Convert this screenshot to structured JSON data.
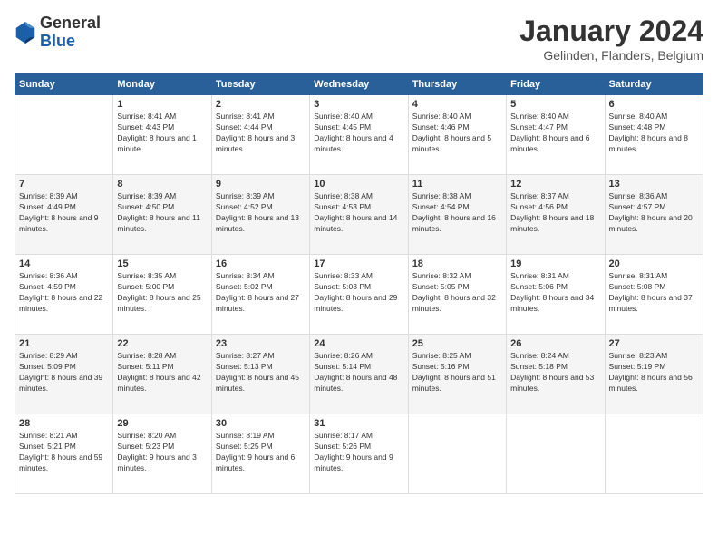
{
  "header": {
    "logo_general": "General",
    "logo_blue": "Blue",
    "month_title": "January 2024",
    "subtitle": "Gelinden, Flanders, Belgium"
  },
  "columns": [
    "Sunday",
    "Monday",
    "Tuesday",
    "Wednesday",
    "Thursday",
    "Friday",
    "Saturday"
  ],
  "weeks": [
    [
      {
        "day": "",
        "sunrise": "",
        "sunset": "",
        "daylight": ""
      },
      {
        "day": "1",
        "sunrise": "Sunrise: 8:41 AM",
        "sunset": "Sunset: 4:43 PM",
        "daylight": "Daylight: 8 hours and 1 minute."
      },
      {
        "day": "2",
        "sunrise": "Sunrise: 8:41 AM",
        "sunset": "Sunset: 4:44 PM",
        "daylight": "Daylight: 8 hours and 3 minutes."
      },
      {
        "day": "3",
        "sunrise": "Sunrise: 8:40 AM",
        "sunset": "Sunset: 4:45 PM",
        "daylight": "Daylight: 8 hours and 4 minutes."
      },
      {
        "day": "4",
        "sunrise": "Sunrise: 8:40 AM",
        "sunset": "Sunset: 4:46 PM",
        "daylight": "Daylight: 8 hours and 5 minutes."
      },
      {
        "day": "5",
        "sunrise": "Sunrise: 8:40 AM",
        "sunset": "Sunset: 4:47 PM",
        "daylight": "Daylight: 8 hours and 6 minutes."
      },
      {
        "day": "6",
        "sunrise": "Sunrise: 8:40 AM",
        "sunset": "Sunset: 4:48 PM",
        "daylight": "Daylight: 8 hours and 8 minutes."
      }
    ],
    [
      {
        "day": "7",
        "sunrise": "Sunrise: 8:39 AM",
        "sunset": "Sunset: 4:49 PM",
        "daylight": "Daylight: 8 hours and 9 minutes."
      },
      {
        "day": "8",
        "sunrise": "Sunrise: 8:39 AM",
        "sunset": "Sunset: 4:50 PM",
        "daylight": "Daylight: 8 hours and 11 minutes."
      },
      {
        "day": "9",
        "sunrise": "Sunrise: 8:39 AM",
        "sunset": "Sunset: 4:52 PM",
        "daylight": "Daylight: 8 hours and 13 minutes."
      },
      {
        "day": "10",
        "sunrise": "Sunrise: 8:38 AM",
        "sunset": "Sunset: 4:53 PM",
        "daylight": "Daylight: 8 hours and 14 minutes."
      },
      {
        "day": "11",
        "sunrise": "Sunrise: 8:38 AM",
        "sunset": "Sunset: 4:54 PM",
        "daylight": "Daylight: 8 hours and 16 minutes."
      },
      {
        "day": "12",
        "sunrise": "Sunrise: 8:37 AM",
        "sunset": "Sunset: 4:56 PM",
        "daylight": "Daylight: 8 hours and 18 minutes."
      },
      {
        "day": "13",
        "sunrise": "Sunrise: 8:36 AM",
        "sunset": "Sunset: 4:57 PM",
        "daylight": "Daylight: 8 hours and 20 minutes."
      }
    ],
    [
      {
        "day": "14",
        "sunrise": "Sunrise: 8:36 AM",
        "sunset": "Sunset: 4:59 PM",
        "daylight": "Daylight: 8 hours and 22 minutes."
      },
      {
        "day": "15",
        "sunrise": "Sunrise: 8:35 AM",
        "sunset": "Sunset: 5:00 PM",
        "daylight": "Daylight: 8 hours and 25 minutes."
      },
      {
        "day": "16",
        "sunrise": "Sunrise: 8:34 AM",
        "sunset": "Sunset: 5:02 PM",
        "daylight": "Daylight: 8 hours and 27 minutes."
      },
      {
        "day": "17",
        "sunrise": "Sunrise: 8:33 AM",
        "sunset": "Sunset: 5:03 PM",
        "daylight": "Daylight: 8 hours and 29 minutes."
      },
      {
        "day": "18",
        "sunrise": "Sunrise: 8:32 AM",
        "sunset": "Sunset: 5:05 PM",
        "daylight": "Daylight: 8 hours and 32 minutes."
      },
      {
        "day": "19",
        "sunrise": "Sunrise: 8:31 AM",
        "sunset": "Sunset: 5:06 PM",
        "daylight": "Daylight: 8 hours and 34 minutes."
      },
      {
        "day": "20",
        "sunrise": "Sunrise: 8:31 AM",
        "sunset": "Sunset: 5:08 PM",
        "daylight": "Daylight: 8 hours and 37 minutes."
      }
    ],
    [
      {
        "day": "21",
        "sunrise": "Sunrise: 8:29 AM",
        "sunset": "Sunset: 5:09 PM",
        "daylight": "Daylight: 8 hours and 39 minutes."
      },
      {
        "day": "22",
        "sunrise": "Sunrise: 8:28 AM",
        "sunset": "Sunset: 5:11 PM",
        "daylight": "Daylight: 8 hours and 42 minutes."
      },
      {
        "day": "23",
        "sunrise": "Sunrise: 8:27 AM",
        "sunset": "Sunset: 5:13 PM",
        "daylight": "Daylight: 8 hours and 45 minutes."
      },
      {
        "day": "24",
        "sunrise": "Sunrise: 8:26 AM",
        "sunset": "Sunset: 5:14 PM",
        "daylight": "Daylight: 8 hours and 48 minutes."
      },
      {
        "day": "25",
        "sunrise": "Sunrise: 8:25 AM",
        "sunset": "Sunset: 5:16 PM",
        "daylight": "Daylight: 8 hours and 51 minutes."
      },
      {
        "day": "26",
        "sunrise": "Sunrise: 8:24 AM",
        "sunset": "Sunset: 5:18 PM",
        "daylight": "Daylight: 8 hours and 53 minutes."
      },
      {
        "day": "27",
        "sunrise": "Sunrise: 8:23 AM",
        "sunset": "Sunset: 5:19 PM",
        "daylight": "Daylight: 8 hours and 56 minutes."
      }
    ],
    [
      {
        "day": "28",
        "sunrise": "Sunrise: 8:21 AM",
        "sunset": "Sunset: 5:21 PM",
        "daylight": "Daylight: 8 hours and 59 minutes."
      },
      {
        "day": "29",
        "sunrise": "Sunrise: 8:20 AM",
        "sunset": "Sunset: 5:23 PM",
        "daylight": "Daylight: 9 hours and 3 minutes."
      },
      {
        "day": "30",
        "sunrise": "Sunrise: 8:19 AM",
        "sunset": "Sunset: 5:25 PM",
        "daylight": "Daylight: 9 hours and 6 minutes."
      },
      {
        "day": "31",
        "sunrise": "Sunrise: 8:17 AM",
        "sunset": "Sunset: 5:26 PM",
        "daylight": "Daylight: 9 hours and 9 minutes."
      },
      {
        "day": "",
        "sunrise": "",
        "sunset": "",
        "daylight": ""
      },
      {
        "day": "",
        "sunrise": "",
        "sunset": "",
        "daylight": ""
      },
      {
        "day": "",
        "sunrise": "",
        "sunset": "",
        "daylight": ""
      }
    ]
  ]
}
